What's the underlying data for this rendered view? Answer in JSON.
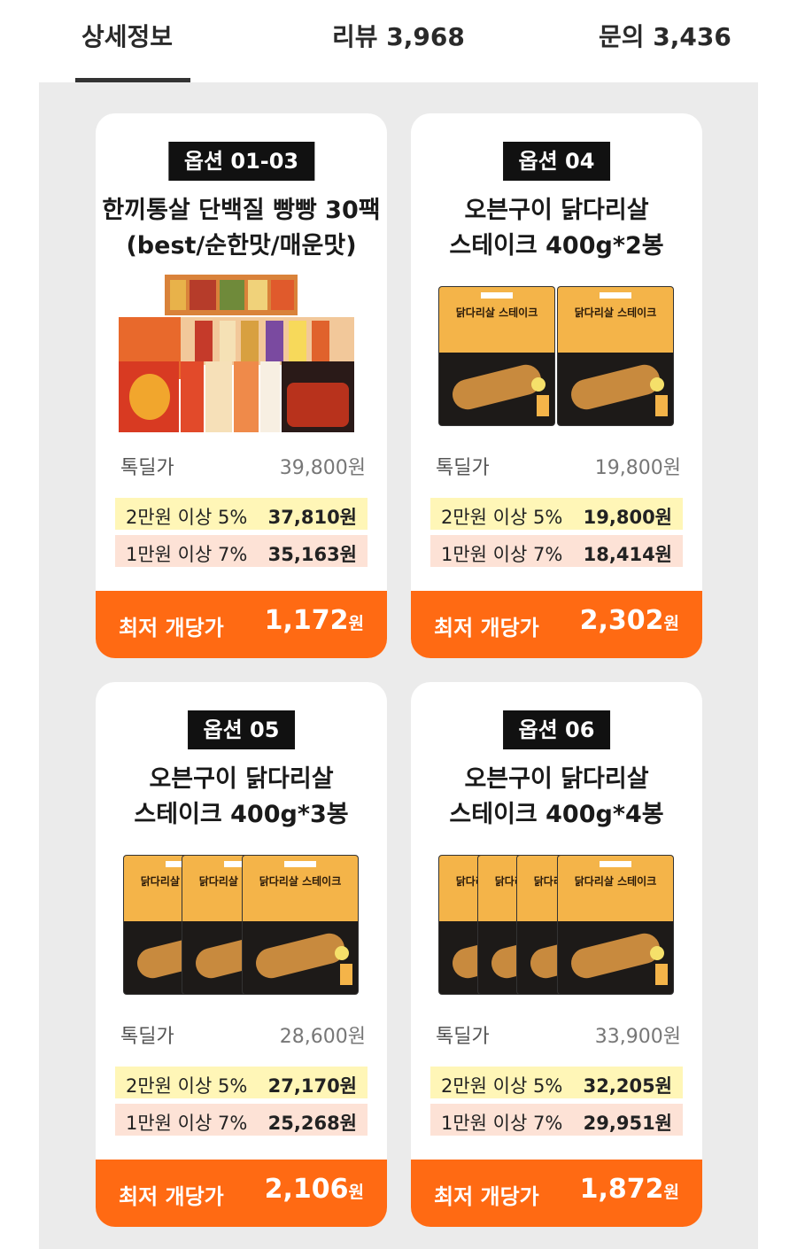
{
  "tabs": [
    {
      "label": "상세정보",
      "active": true
    },
    {
      "label": "리뷰 3,968"
    },
    {
      "label": "문의 3,436"
    }
  ],
  "cards": [
    {
      "option": "옵션 01-03",
      "title_lines": [
        "한끼통살 단백질 빵빵 30팩",
        "(best/순한맛/매운맛)"
      ],
      "base_label": "톡딜가",
      "base_price": "39,800원",
      "disc1_label": "2만원 이상 5%",
      "disc1_price": "37,810원",
      "disc2_label": "1만원 이상 7%",
      "disc2_price": "35,163원",
      "unit_label": "최저 개당가",
      "unit_price": "1,172",
      "unit_suffix": "원"
    },
    {
      "option": "옵션 04",
      "title_lines": [
        "오븐구이 닭다리살",
        "스테이크 400g*2봉"
      ],
      "pack_label": "닭다리살 스테이크",
      "base_label": "톡딜가",
      "base_price": "19,800원",
      "disc1_label": "2만원 이상 5%",
      "disc1_price": "19,800원",
      "disc2_label": "1만원 이상 7%",
      "disc2_price": "18,414원",
      "unit_label": "최저 개당가",
      "unit_price": "2,302",
      "unit_suffix": "원"
    },
    {
      "option": "옵션 05",
      "title_lines": [
        "오븐구이 닭다리살",
        "스테이크 400g*3봉"
      ],
      "pack_label": "닭다리살 스테이크",
      "base_label": "톡딜가",
      "base_price": "28,600원",
      "disc1_label": "2만원 이상 5%",
      "disc1_price": "27,170원",
      "disc2_label": "1만원 이상 7%",
      "disc2_price": "25,268원",
      "unit_label": "최저 개당가",
      "unit_price": "2,106",
      "unit_suffix": "원"
    },
    {
      "option": "옵션 06",
      "title_lines": [
        "오븐구이 닭다리살",
        "스테이크 400g*4봉"
      ],
      "pack_label": "닭다리살 스테이크",
      "base_label": "톡딜가",
      "base_price": "33,900원",
      "disc1_label": "2만원 이상 5%",
      "disc1_price": "32,205원",
      "disc2_label": "1만원 이상 7%",
      "disc2_price": "29,951원",
      "unit_label": "최저 개당가",
      "unit_price": "1,872",
      "unit_suffix": "원"
    }
  ],
  "colors": {
    "accent": "#ff6a13",
    "badge": "#111111",
    "disc_yellow": "#fff6b7",
    "disc_peach": "#fde2d6",
    "panel_bg": "#ebebeb"
  }
}
